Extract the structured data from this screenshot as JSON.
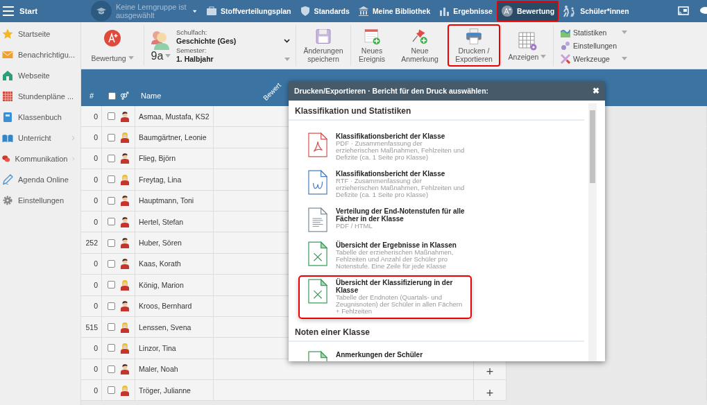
{
  "topbar": {
    "menu_label": "Start",
    "group_selector": {
      "text": "Keine Lerngruppe ist ausgewählt"
    },
    "nav": [
      {
        "label": "Stoffverteilungsplan",
        "selected": false,
        "highlighted": false
      },
      {
        "label": "Standards",
        "selected": false,
        "highlighted": false
      },
      {
        "label": "Meine Bibliothek",
        "selected": false,
        "highlighted": false
      },
      {
        "label": "Ergebnisse",
        "selected": false,
        "highlighted": false
      },
      {
        "label": "Bewertung",
        "selected": true,
        "highlighted": true
      },
      {
        "label": "Schüler*innen",
        "selected": false,
        "highlighted": false
      }
    ]
  },
  "sidebar": {
    "items": [
      {
        "label": "Startseite",
        "expandable": false
      },
      {
        "label": "Benachrichtigu...",
        "expandable": false
      },
      {
        "label": "Webseite",
        "expandable": false
      },
      {
        "label": "Stundenpläne ...",
        "expandable": false
      },
      {
        "label": "Klassenbuch",
        "expandable": false
      },
      {
        "label": "Unterricht",
        "expandable": true
      },
      {
        "label": "Kommunikation",
        "expandable": true
      },
      {
        "label": "Agenda Online",
        "expandable": false
      },
      {
        "label": "Einstellungen",
        "expandable": false
      }
    ]
  },
  "toolbar": {
    "mode": {
      "label": "Bewertung"
    },
    "class_selector": {
      "class": "9a",
      "subject_label": "Schulfach:",
      "subject": "Geschichte (Ges)",
      "semester_label": "Semester:",
      "semester": "1. Halbjahr"
    },
    "buttons": [
      {
        "label": "Änderungen speichern",
        "highlighted": false,
        "dropdown": false
      },
      {
        "label": "Neues Ereignis",
        "highlighted": false,
        "dropdown": false
      },
      {
        "label": "Neue Anmerkung",
        "highlighted": false,
        "dropdown": false
      },
      {
        "label": "Drucken / Exportieren",
        "highlighted": true,
        "dropdown": false
      },
      {
        "label": "Anzeigen",
        "highlighted": false,
        "dropdown": true
      }
    ],
    "menu": [
      {
        "label": "Statistiken",
        "dropdown": true
      },
      {
        "label": "Einstellungen",
        "dropdown": false
      },
      {
        "label": "Werkzeuge",
        "dropdown": true
      }
    ]
  },
  "table": {
    "columns": {
      "count": "#",
      "select_all": {
        "checked": false
      },
      "gender_symbol": "⚤",
      "name": "Name",
      "rotated": "Bewert"
    },
    "rows": [
      {
        "count": "0",
        "checked": false,
        "kind": "male",
        "name": "Asmaa, Mustafa, KS2"
      },
      {
        "count": "0",
        "checked": false,
        "kind": "female",
        "name": "Baumgärtner, Leonie"
      },
      {
        "count": "0",
        "checked": false,
        "kind": "male",
        "name": "Flieg, Björn"
      },
      {
        "count": "0",
        "checked": false,
        "kind": "female",
        "name": "Freytag, Lina"
      },
      {
        "count": "0",
        "checked": false,
        "kind": "male",
        "name": "Hauptmann, Toni"
      },
      {
        "count": "0",
        "checked": false,
        "kind": "male",
        "name": "Hertel, Stefan"
      },
      {
        "count": "252",
        "checked": false,
        "kind": "male",
        "name": "Huber, Sören"
      },
      {
        "count": "0",
        "checked": false,
        "kind": "male",
        "name": "Kaas, Korath"
      },
      {
        "count": "0",
        "checked": false,
        "kind": "female",
        "name": "König, Marion"
      },
      {
        "count": "0",
        "checked": false,
        "kind": "male",
        "name": "Kroos, Bernhard"
      },
      {
        "count": "515",
        "checked": false,
        "kind": "female",
        "name": "Lenssen, Svena"
      },
      {
        "count": "0",
        "checked": false,
        "kind": "female",
        "name": "Linzor, Tina"
      },
      {
        "count": "0",
        "checked": false,
        "kind": "male",
        "name": "Maler, Noah",
        "plus": "+"
      },
      {
        "count": "0",
        "checked": false,
        "kind": "female",
        "name": "Tröger, Julianne",
        "plus": "+"
      }
    ]
  },
  "dialog": {
    "title": "Drucken/Exportieren · Bericht für den Druck auswählen:",
    "close": "✖",
    "sections": [
      {
        "heading": "Klassifikation und Statistiken",
        "items": [
          {
            "title": "Klassifikationsbericht der Klasse",
            "description": "PDF · Zusammenfassung der erzieherischen Maßnahmen, Fehlzeiten und Defizite (ca. 1 Seite pro Klasse)",
            "kind": "pdf",
            "highlighted": false
          },
          {
            "title": "Klassifikationsbericht der Klasse",
            "description": "RTF · Zusammenfassung der erzieherischen Maßnahmen, Fehlzeiten und Defizite (ca. 1 Seite pro Klasse)",
            "kind": "rtf",
            "highlighted": false
          },
          {
            "title": "Verteilung der End-Notenstufen für alle Fächer in der Klasse",
            "description": "PDF / HTML",
            "kind": "doc",
            "highlighted": false
          },
          {
            "title": "Übersicht der Ergebnisse in Klassen",
            "description": "Tabelle der erzieherischen Maßnahmen, Fehlzeiten und Anzahl der Schüler pro Notenstufe. Eine Zeile für jede Klasse",
            "kind": "xls",
            "highlighted": false
          },
          {
            "title": "Übersicht der Klassifizierung in der Klasse",
            "description": "Tabelle der Endnoten (Quartals- und Zeugnisnoten) der Schüler in allen Fächern + Fehlzeiten",
            "kind": "xls",
            "highlighted": true
          }
        ]
      },
      {
        "heading": "Noten einer Klasse",
        "items": [
          {
            "title": "Anmerkungen der Schüler",
            "kind": "xls",
            "highlighted": false
          }
        ]
      }
    ]
  }
}
